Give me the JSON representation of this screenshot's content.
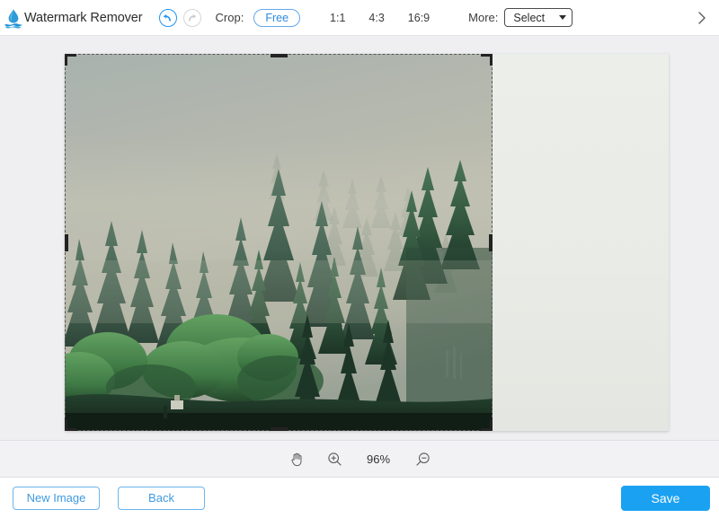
{
  "app": {
    "title": "Watermark Remover",
    "logo_icon": "water-drop-icon",
    "accent_color": "#1ba1f2",
    "brand_color": "#2196f3"
  },
  "header": {
    "undo_icon": "undo-arrow-icon",
    "redo_icon": "redo-arrow-icon",
    "crop_label": "Crop:",
    "ratios": [
      {
        "label": "Free",
        "selected": true
      },
      {
        "label": "1:1",
        "selected": false
      },
      {
        "label": "4:3",
        "selected": false
      },
      {
        "label": "16:9",
        "selected": false
      }
    ],
    "more_label": "More:",
    "select_value": "Select",
    "caret_icon": "chevron-down-icon",
    "next_icon": "chevron-right-icon"
  },
  "canvas": {
    "image_alt": "misty-forest-photo",
    "crop_selection": {
      "handles": [
        "top-left",
        "top-center",
        "top-right",
        "middle-left",
        "middle-right",
        "bottom-left",
        "bottom-center",
        "bottom-right"
      ]
    }
  },
  "zoombar": {
    "pan_icon": "hand-pan-icon",
    "zoom_in_icon": "zoom-in-icon",
    "zoom_out_icon": "zoom-out-icon",
    "zoom_level": "96%"
  },
  "footer": {
    "new_image_label": "New Image",
    "back_label": "Back",
    "save_label": "Save"
  }
}
